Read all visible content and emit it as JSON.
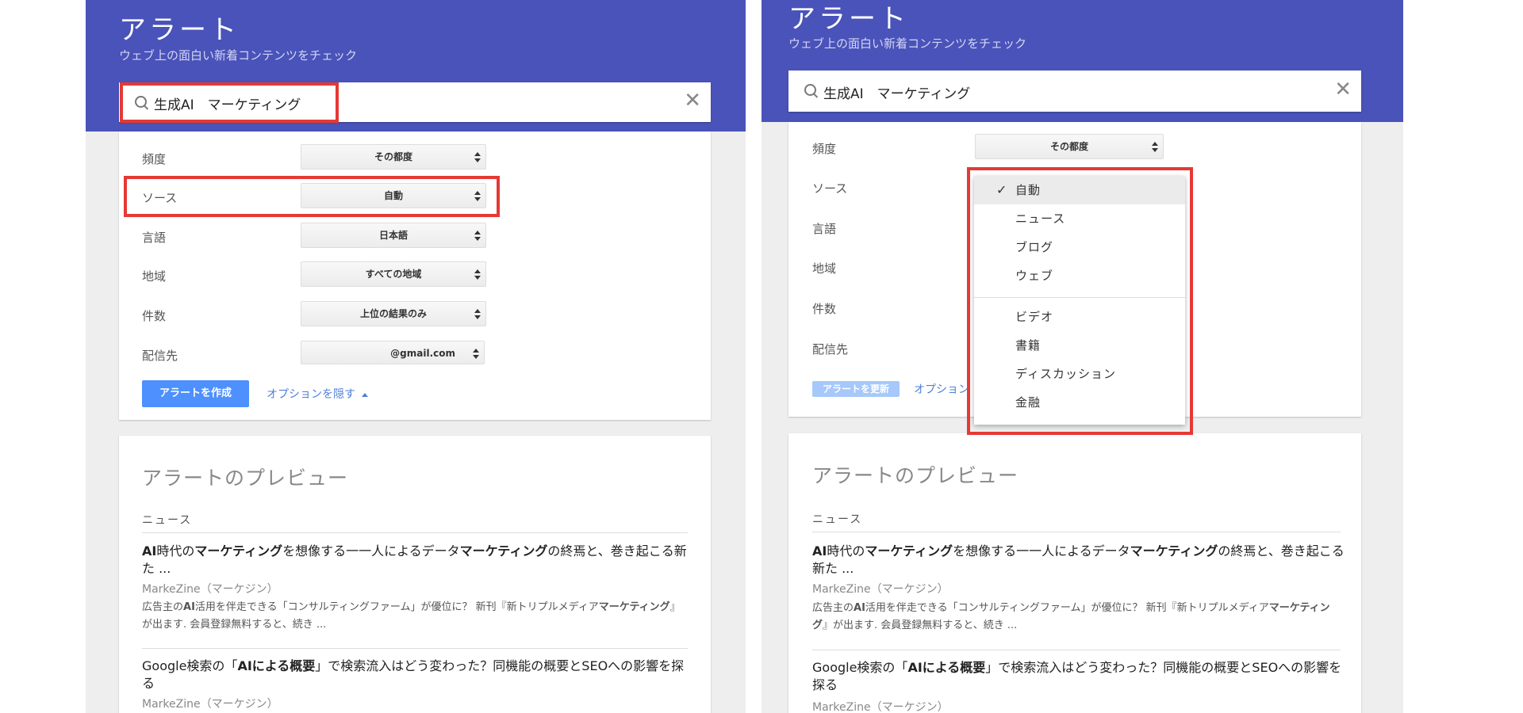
{
  "app": {
    "title": "アラート",
    "subtitle": "ウェブ上の面白い新着コンテンツをチェック"
  },
  "search": {
    "query": "生成AI　マーケティング",
    "clear_symbol": "✕"
  },
  "options": {
    "frequency_label": "頻度",
    "frequency_value": "その都度",
    "source_label": "ソース",
    "source_value": "自動",
    "language_label": "言語",
    "language_value": "日本語",
    "region_label": "地域",
    "region_value": "すべての地域",
    "count_label": "件数",
    "count_value": "上位の結果のみ",
    "deliver_label": "配信先",
    "deliver_value": "@gmail.com"
  },
  "actions": {
    "create_label": "アラートを作成",
    "update_label": "アラートを更新",
    "hide_options_label": "オプションを隠す",
    "hide_options_partial": "オプション"
  },
  "source_dropdown": {
    "items": [
      "自動",
      "ニュース",
      "ブログ",
      "ウェブ",
      "ビデオ",
      "書籍",
      "ディスカッション",
      "金融"
    ],
    "selected": "自動",
    "check_symbol": "✓"
  },
  "preview": {
    "title": "アラートのプレビュー",
    "section": "ニュース",
    "articles": [
      {
        "title_parts": [
          "AI",
          "時代の",
          "マーケティング",
          "を想像する一一人によるデータ",
          "マーケティング",
          "の終焉と、巻き起こる新た ..."
        ],
        "source": "MarkeZine（マーケジン）",
        "snippet_parts": [
          "広告主の",
          "AI",
          "活用を伴走できる「コンサルティングファーム」が優位に？ 新刊『新トリプルメディア",
          "マーケティング",
          "』が出ます. 会員登録無料すると、続き ..."
        ]
      },
      {
        "title_parts": [
          "Google検索の「",
          "AIによる概要",
          "」で検索流入はどう変わった？同機能の概要とSEOへの影響を探る"
        ],
        "source": "MarkeZine（マーケジン）"
      }
    ]
  },
  "colors": {
    "header_bg": "#4a53b9",
    "primary_button": "#4d90fe",
    "highlight_box": "#e53935"
  }
}
